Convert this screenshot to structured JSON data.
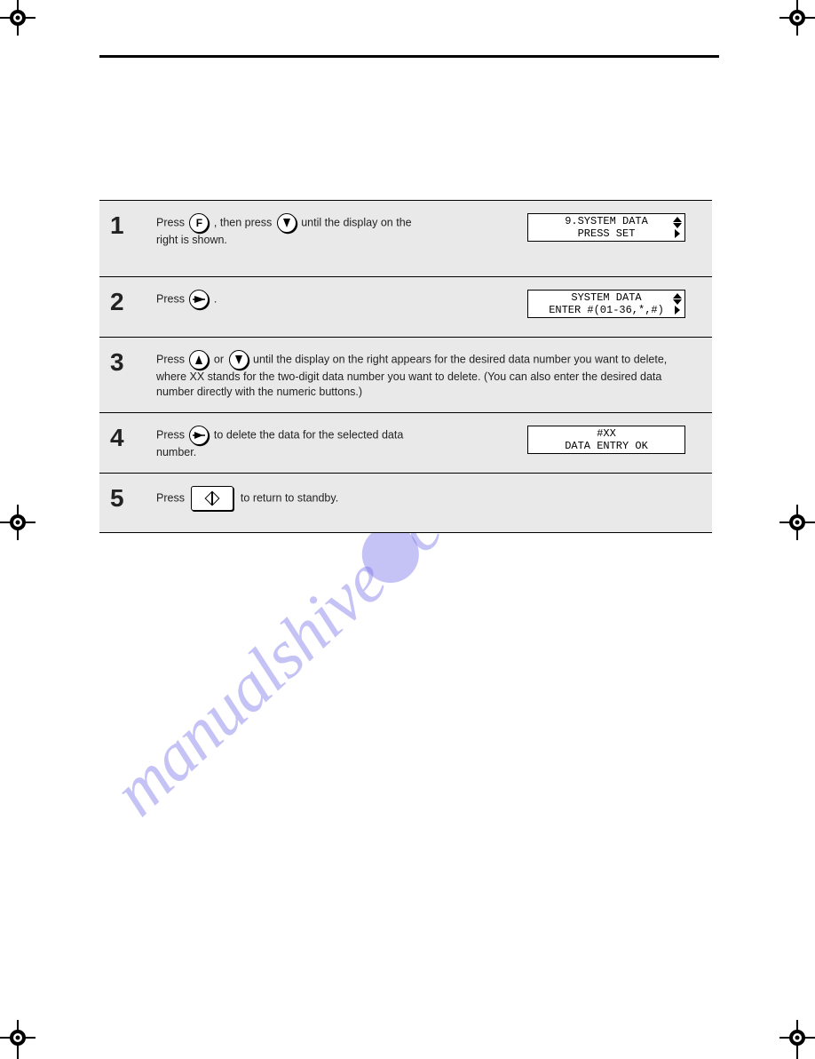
{
  "watermark": "manualshive.com",
  "steps": {
    "s1": {
      "num": "1",
      "text_1_prefix": "Press ",
      "text_1_mid": ", then press ",
      "text_1_suffix": " until the display on the right is shown.",
      "display_line1": "9.SYSTEM DATA",
      "display_line2": "PRESS SET"
    },
    "s2": {
      "num": "2",
      "text_2_prefix": "Press ",
      "text_2_suffix": ".",
      "display_line1": "SYSTEM DATA",
      "display_line2": "ENTER #(01-36,*,#)"
    },
    "s3": {
      "num": "3",
      "text_3_prefix": "Press ",
      "text_3_mid": " or ",
      "text_3_end": " until the display on the right appears for the desired data number you want to delete, where XX stands for the two-digit data number you want to delete. (You can also enter the desired data number directly with the numeric buttons.)"
    },
    "s4": {
      "num": "4",
      "text_4_prefix": "Press ",
      "text_4_suffix": " to delete the data for the selected data number.",
      "display_line1": "#XX",
      "display_line2": "DATA ENTRY OK"
    },
    "s5": {
      "num": "5",
      "text_5_prefix": "Press ",
      "text_5_suffix": " to return to standby."
    }
  }
}
